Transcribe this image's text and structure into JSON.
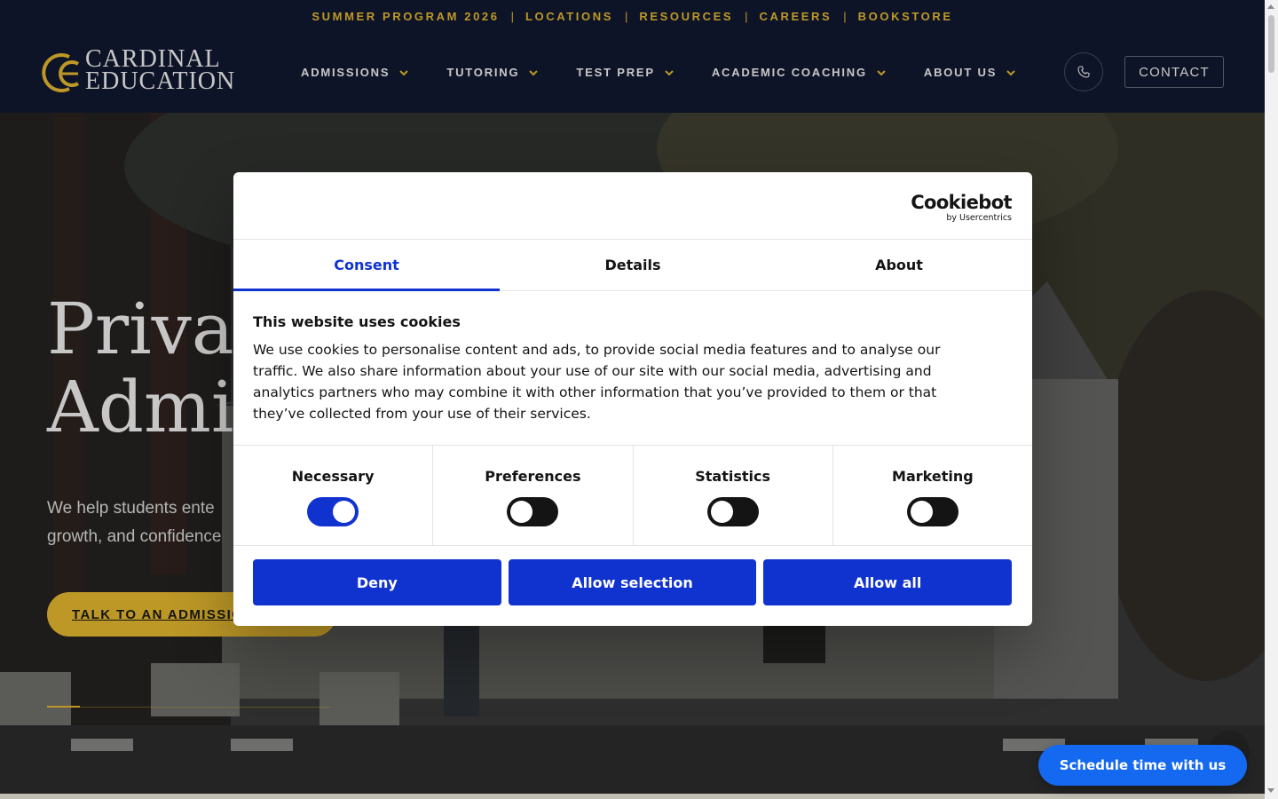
{
  "topbar": {
    "links": [
      "SUMMER PROGRAM 2026",
      "LOCATIONS",
      "RESOURCES",
      "CAREERS",
      "BOOKSTORE"
    ],
    "separator": "|"
  },
  "header": {
    "logo_line1": "CARDINAL",
    "logo_line2": "EDUCATION",
    "nav": [
      "ADMISSIONS",
      "TUTORING",
      "TEST PREP",
      "ACADEMIC COACHING",
      "ABOUT US"
    ],
    "phone_icon": "phone-icon",
    "contact_label": "CONTACT"
  },
  "hero": {
    "title_line1": "Privat",
    "title_line2": "Admis",
    "subtitle_line1": "We help students ente",
    "subtitle_line2": "growth, and confidence",
    "cta_label": "TALK TO AN ADMISSIO"
  },
  "cookie_dialog": {
    "brand_name": "Cookiebot",
    "brand_by": "by Usercentrics",
    "tabs": [
      "Consent",
      "Details",
      "About"
    ],
    "active_tab": "Consent",
    "title": "This website uses cookies",
    "body": "We use cookies to personalise content and ads, to provide social media features and to analyse our traffic. We also share information about your use of our site with our social media, advertising and analytics partners who may combine it with other information that you’ve provided to them or that they’ve collected from your use of their services.",
    "toggles": [
      {
        "label": "Necessary",
        "on": true
      },
      {
        "label": "Preferences",
        "on": false
      },
      {
        "label": "Statistics",
        "on": false
      },
      {
        "label": "Marketing",
        "on": false
      }
    ],
    "buttons": [
      "Deny",
      "Allow selection",
      "Allow all"
    ]
  },
  "widgets": {
    "schedule_label": "Schedule time with us"
  },
  "colors": {
    "accent_gold": "#f3c332",
    "navy": "#121a33",
    "cookie_blue": "#1032cf",
    "schedule_blue": "#1569f0"
  }
}
